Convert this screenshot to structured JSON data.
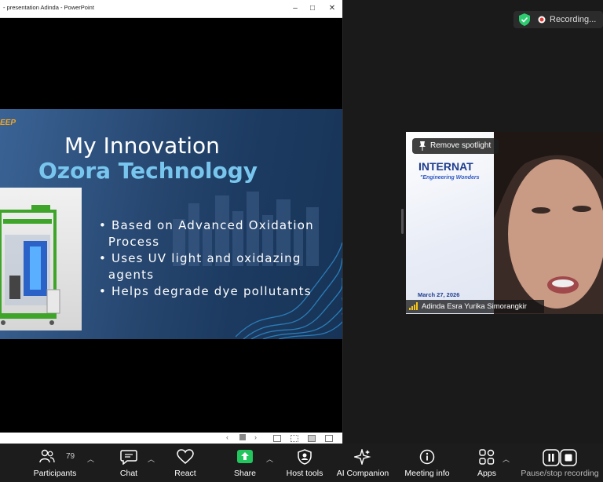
{
  "ppt_window": {
    "title": "- presentation Adinda - PowerPoint",
    "minimize": "–",
    "maximize": "□",
    "close": "✕"
  },
  "slide": {
    "title": "My Innovation",
    "subtitle": "Ozora Technology",
    "bullets": [
      "• Based on Advanced Oxidation",
      "  Process",
      "• Uses UV light and oxidazing",
      "  agents",
      "• Helps degrade dye pollutants"
    ],
    "logo_text": "EEP"
  },
  "recording": {
    "label": "Recording...",
    "shield_color": "#2ecc71"
  },
  "video": {
    "spotlight_label": "Remove spotlight",
    "participant_name": "Adinda Esra Yurika Simorangkir",
    "bg_banner_title": "INTERNAT",
    "bg_banner_tagline": "\"Engineering Wonders",
    "bg_banner_date": "March 27, 2026"
  },
  "toolbar": {
    "participants_label": "Participants",
    "participants_count": "79",
    "chat_label": "Chat",
    "react_label": "React",
    "share_label": "Share",
    "host_tools_label": "Host tools",
    "ai_companion_label": "AI Companion",
    "meeting_info_label": "Meeting info",
    "apps_label": "Apps",
    "pause_stop_label": "Pause/stop recording",
    "share_color": "#22c55e"
  }
}
